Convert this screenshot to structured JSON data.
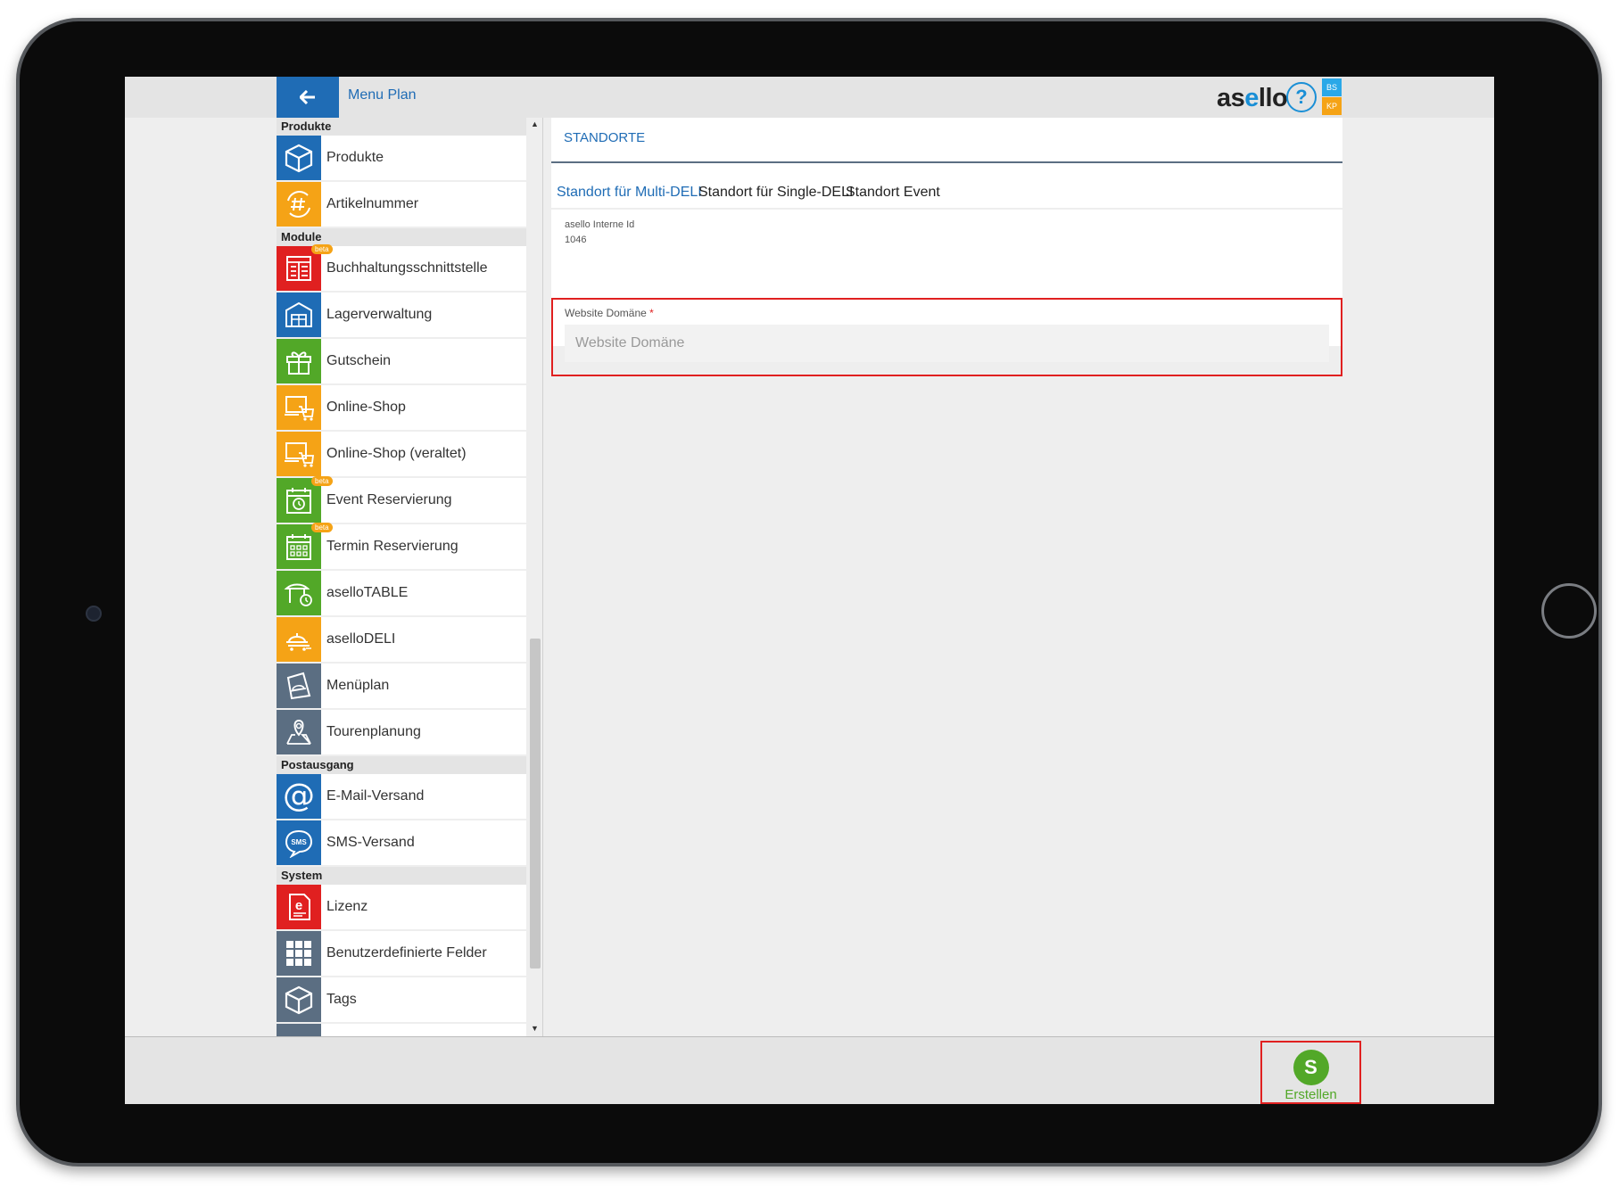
{
  "header": {
    "title": "Menu Plan",
    "logo_main": "as",
    "logo_accent": "e",
    "logo_tail": "llo",
    "help_symbol": "?",
    "badge_top": "BS",
    "badge_bottom": "KP"
  },
  "sidebar": {
    "sections": [
      {
        "heading": "Produkte",
        "items": [
          {
            "label": "Produkte",
            "icon": "box-icon",
            "color": "#1f6cb5"
          },
          {
            "label": "Artikelnummer",
            "icon": "hash-cycle-icon",
            "color": "#f5a316"
          }
        ]
      },
      {
        "heading": "Module",
        "items": [
          {
            "label": "Buchhaltungsschnittstelle",
            "icon": "ledger-icon",
            "color": "#e02020",
            "badge": "beta"
          },
          {
            "label": "Lagerverwaltung",
            "icon": "warehouse-icon",
            "color": "#1f6cb5"
          },
          {
            "label": "Gutschein",
            "icon": "gift-icon",
            "color": "#52a828"
          },
          {
            "label": "Online-Shop",
            "icon": "shop-cart-icon",
            "color": "#f5a316"
          },
          {
            "label": "Online-Shop (veraltet)",
            "icon": "shop-cart-icon",
            "color": "#f5a316"
          },
          {
            "label": "Event Reservierung",
            "icon": "calendar-clock-icon",
            "color": "#52a828",
            "badge": "beta"
          },
          {
            "label": "Termin Reservierung",
            "icon": "calendar-grid-icon",
            "color": "#52a828",
            "badge": "beta"
          },
          {
            "label": "aselloTABLE",
            "icon": "table-clock-icon",
            "color": "#52a828"
          },
          {
            "label": "aselloDELI",
            "icon": "cloche-delivery-icon",
            "color": "#f5a316"
          },
          {
            "label": "Menüplan",
            "icon": "menu-card-icon",
            "color": "#5b6e82"
          },
          {
            "label": "Tourenplanung",
            "icon": "map-pin-icon",
            "color": "#5b6e82"
          }
        ]
      },
      {
        "heading": "Postausgang",
        "items": [
          {
            "label": "E-Mail-Versand",
            "icon": "at-icon",
            "color": "#1f6cb5"
          },
          {
            "label": "SMS-Versand",
            "icon": "sms-icon",
            "color": "#1f6cb5"
          }
        ]
      },
      {
        "heading": "System",
        "items": [
          {
            "label": "Lizenz",
            "icon": "license-icon",
            "color": "#e02020"
          },
          {
            "label": "Benutzerdefinierte Felder",
            "icon": "grid-icon",
            "color": "#5b6e82"
          },
          {
            "label": "Tags",
            "icon": "box-icon",
            "color": "#5b6e82"
          }
        ]
      }
    ]
  },
  "main": {
    "card_title": "STANDORTE",
    "tabs": [
      "Standort für Multi-DELI",
      "Standort für Single-DELI",
      "Standort Event"
    ],
    "active_tab": 0,
    "internal_id_label": "asello Interne Id",
    "internal_id_value": "1046",
    "domain_field": {
      "label": "Website Domäne",
      "required_mark": "*",
      "placeholder": "Website Domäne",
      "value": ""
    }
  },
  "footer": {
    "create_symbol": "S",
    "create_label": "Erstellen"
  }
}
